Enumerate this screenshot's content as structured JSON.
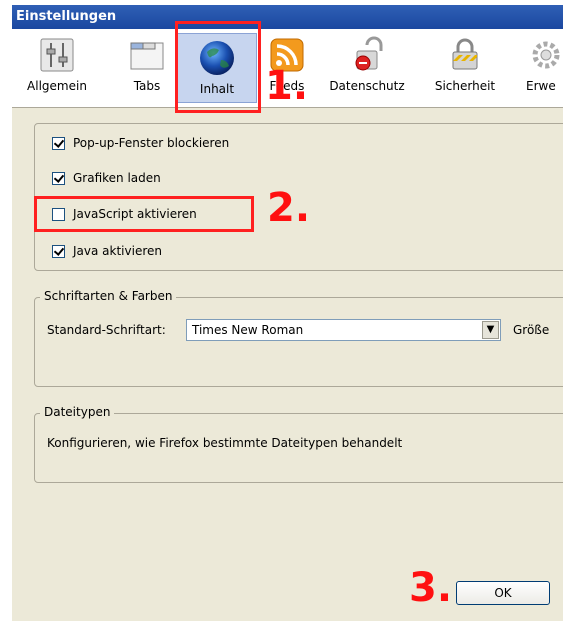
{
  "window": {
    "title": "Einstellungen"
  },
  "toolbar": {
    "items": [
      {
        "label": "Allgemein",
        "icon": "general-switch-icon"
      },
      {
        "label": "Tabs",
        "icon": "tabs-window-icon"
      },
      {
        "label": "Inhalt",
        "icon": "globe-icon",
        "selected": true
      },
      {
        "label": "Feeds",
        "icon": "rss-feed-icon"
      },
      {
        "label": "Datenschutz",
        "icon": "privacy-lock-icon"
      },
      {
        "label": "Sicherheit",
        "icon": "padlock-icon"
      },
      {
        "label": "Erwe",
        "icon": "gear-icon"
      }
    ]
  },
  "content": {
    "checkboxes": [
      {
        "label": "Pop-up-Fenster blockieren",
        "checked": true
      },
      {
        "label": "Grafiken laden",
        "checked": true
      },
      {
        "label": "JavaScript aktivieren",
        "checked": false
      },
      {
        "label": "Java aktivieren",
        "checked": true
      }
    ],
    "fonts": {
      "legend": "Schriftarten & Farben",
      "standard_label": "Standard-Schriftart:",
      "standard_value": "Times New Roman",
      "size_label": "Größe"
    },
    "filetypes": {
      "legend": "Dateitypen",
      "description": "Konfigurieren, wie Firefox bestimmte Dateitypen behandelt"
    }
  },
  "buttons": {
    "ok": "OK"
  },
  "annotations": {
    "step1": "1.",
    "step2": "2.",
    "step3": "3."
  },
  "colors": {
    "annotation": "#ff1010",
    "title_bar": "#1b48a0",
    "dialog_bg": "#ece9d8"
  }
}
